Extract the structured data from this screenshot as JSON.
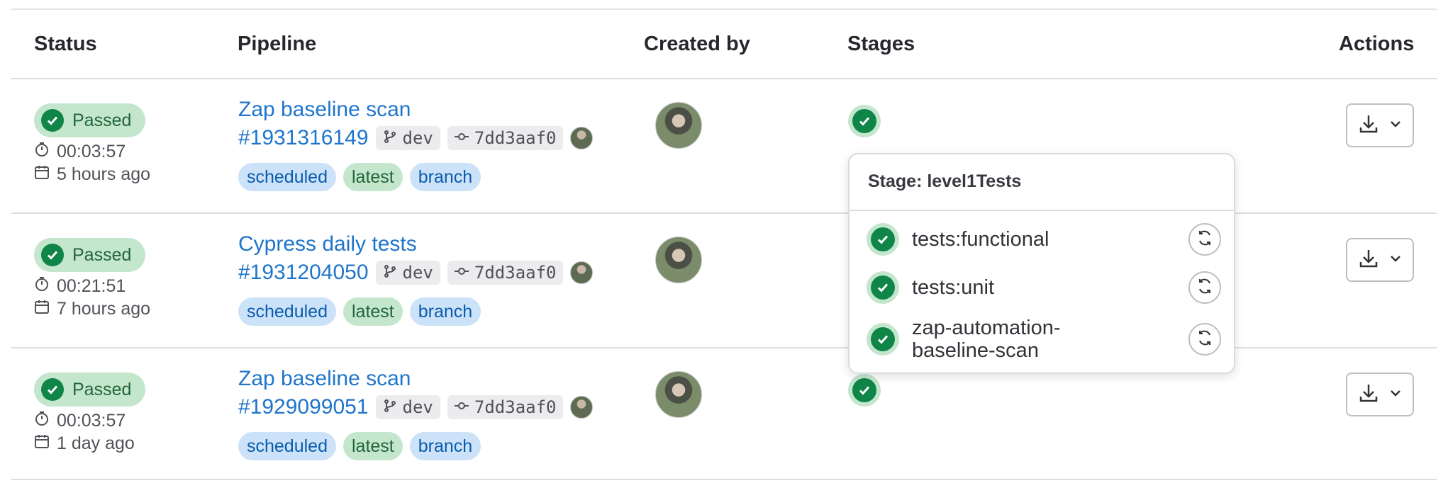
{
  "header": {
    "status": "Status",
    "pipeline": "Pipeline",
    "created_by": "Created by",
    "stages": "Stages",
    "actions": "Actions"
  },
  "rows": [
    {
      "status": "Passed",
      "duration": "00:03:57",
      "finished": "5 hours ago",
      "title": "Zap baseline scan",
      "id": "#1931316149",
      "branch": "dev",
      "commit": "7dd3aaf0",
      "tags": [
        "scheduled",
        "latest",
        "branch"
      ]
    },
    {
      "status": "Passed",
      "duration": "00:21:51",
      "finished": "7 hours ago",
      "title": "Cypress daily tests",
      "id": "#1931204050",
      "branch": "dev",
      "commit": "7dd3aaf0",
      "tags": [
        "scheduled",
        "latest",
        "branch"
      ]
    },
    {
      "status": "Passed",
      "duration": "00:03:57",
      "finished": "1 day ago",
      "title": "Zap baseline scan",
      "id": "#1929099051",
      "branch": "dev",
      "commit": "7dd3aaf0",
      "tags": [
        "scheduled",
        "latest",
        "branch"
      ]
    }
  ],
  "popover": {
    "title": "Stage: level1Tests",
    "jobs": [
      "tests:functional",
      "tests:unit",
      "zap-automation-\nbaseline-scan"
    ]
  },
  "colors": {
    "link": "#1f75cb",
    "success": "#108548",
    "success_bg": "#c3e6cd"
  }
}
